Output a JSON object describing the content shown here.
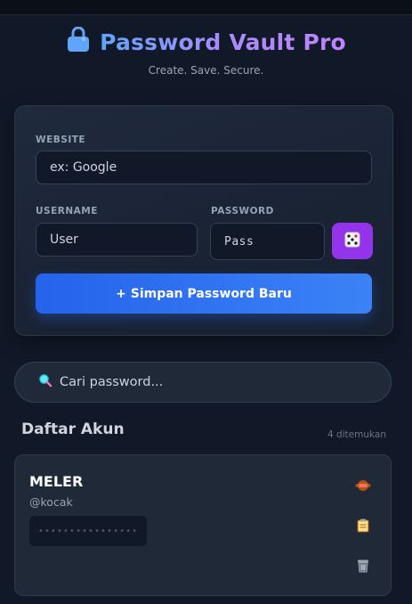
{
  "header": {
    "title": "Password Vault Pro",
    "subtitle": "Create. Save. Secure.",
    "icon": "lock-icon"
  },
  "form": {
    "website_label": "WEBSITE",
    "website_placeholder": "ex: Google",
    "username_label": "USERNAME",
    "username_placeholder": "User",
    "password_label": "PASSWORD",
    "password_placeholder": "Pass",
    "generate_icon": "dice-icon",
    "save_label": "+ Simpan Password Baru"
  },
  "search": {
    "placeholder": "Cari password...",
    "icon": "search-icon"
  },
  "list": {
    "title": "Daftar Akun",
    "count": "4 ditemukan",
    "accounts": [
      {
        "name": "MELER",
        "username": "@kocak",
        "password_masked": "••••••••••••••••",
        "actions": [
          "show-password-icon",
          "copy-icon",
          "delete-icon"
        ]
      }
    ]
  },
  "colors": {
    "background": "#111827",
    "card": "#1f2937",
    "accent_blue": "#3b82f6",
    "accent_purple": "#9333ea"
  }
}
